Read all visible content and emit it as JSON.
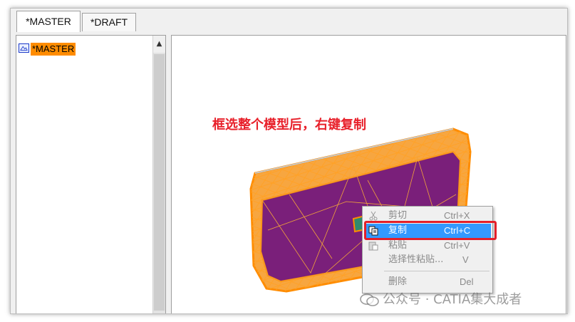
{
  "tabs": [
    {
      "label": "*MASTER",
      "active": true
    },
    {
      "label": "*DRAFT",
      "active": false
    }
  ],
  "tree": {
    "root_label": "*MASTER",
    "scroll_up_glyph": "▲"
  },
  "viewport": {
    "annotation": "框选整个模型后，右键复制",
    "annotation_color": "#e8202a",
    "model_colors": {
      "wireframe": "#ff8c00",
      "surface": "#7a1f7a",
      "panel": "#2f8a6e"
    }
  },
  "context_menu": {
    "items": [
      {
        "label": "剪切",
        "shortcut": "Ctrl+X",
        "icon": "scissors-icon",
        "enabled": false
      },
      {
        "label": "复制",
        "shortcut": "Ctrl+C",
        "icon": "copy-icon",
        "enabled": true,
        "highlighted": true
      },
      {
        "label": "粘贴",
        "shortcut": "Ctrl+V",
        "icon": "paste-icon",
        "enabled": false
      },
      {
        "label": "选择性粘贴...",
        "shortcut": "V",
        "enabled": false
      },
      {
        "label": "删除",
        "shortcut": "Del",
        "enabled": false
      }
    ],
    "highlight_color": "#3399ff",
    "callout_color": "#e3202a"
  },
  "watermark": {
    "text": "公众号 · CATIA集大成者",
    "icon": "wechat-icon"
  }
}
